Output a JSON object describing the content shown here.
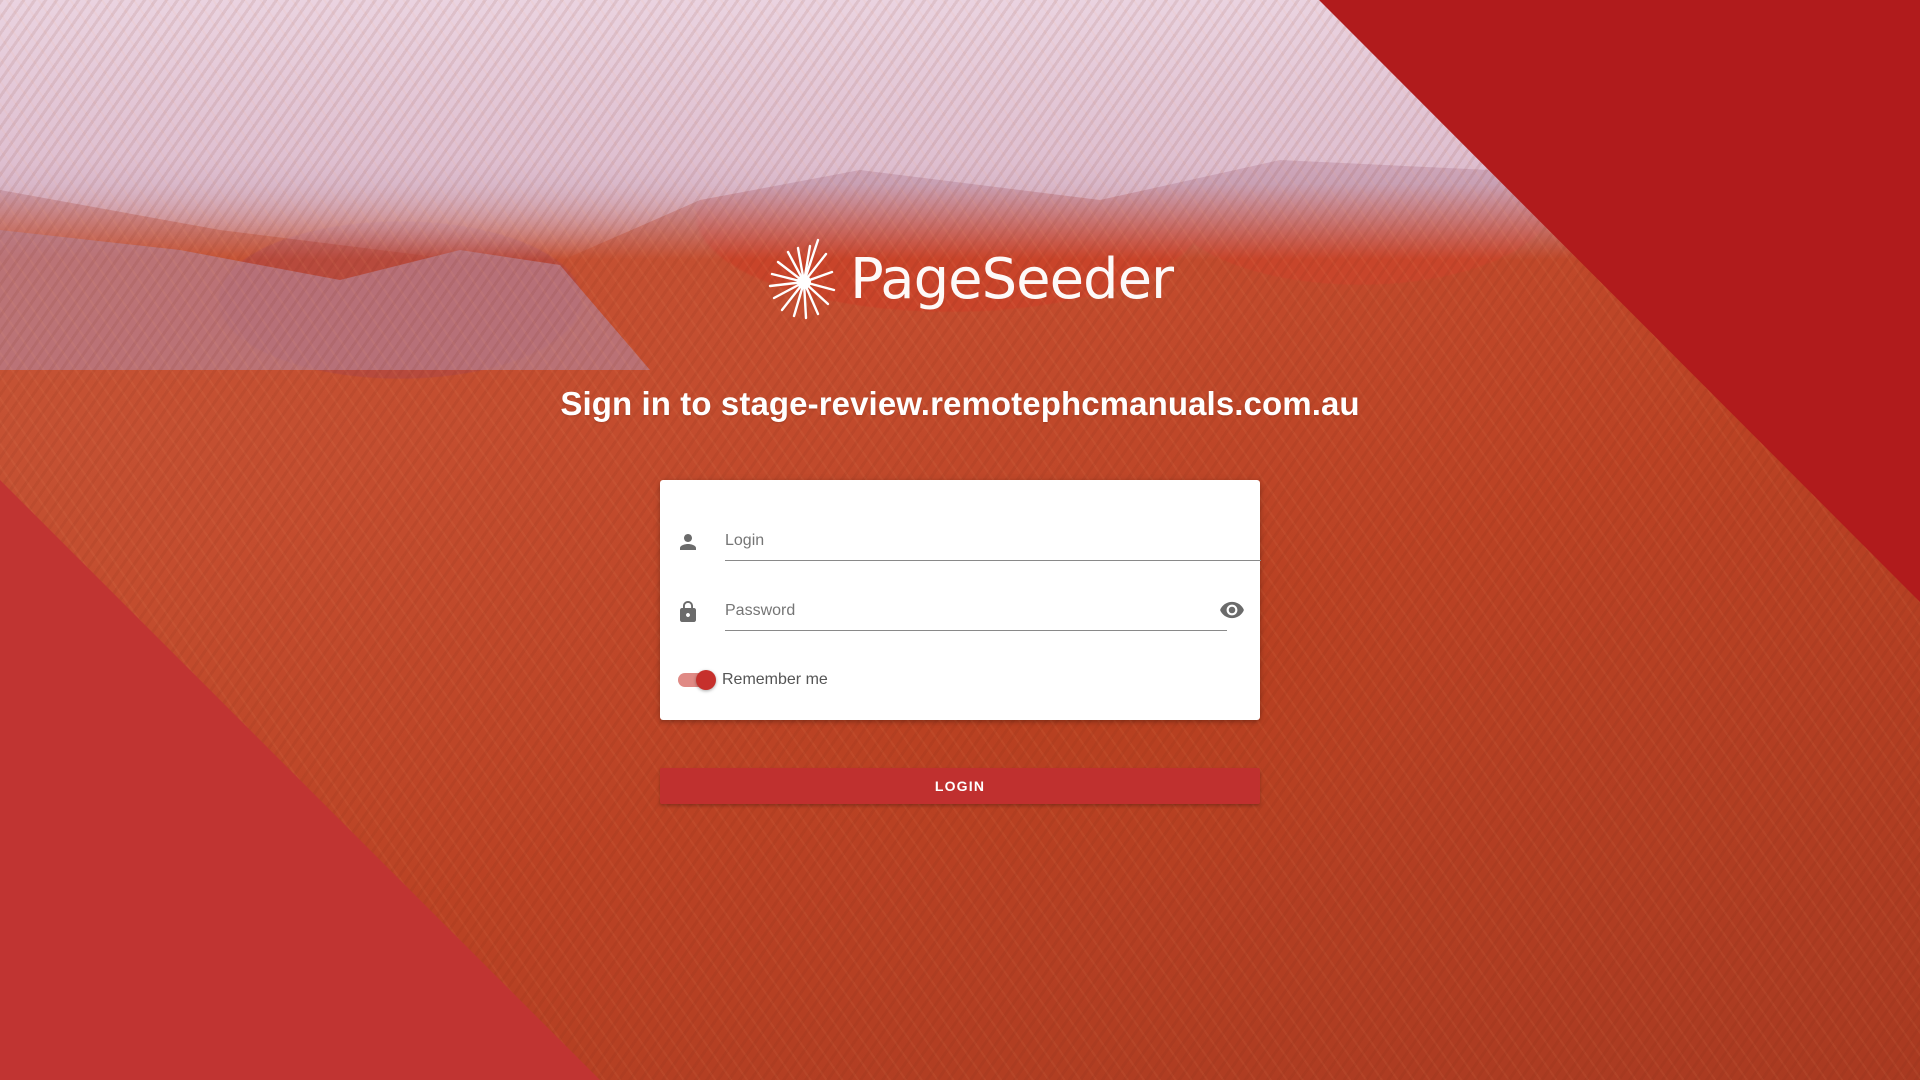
{
  "brand": {
    "name": "PageSeeder",
    "logo_icon": "pageseeder-burst-icon"
  },
  "signin": {
    "title": "Sign in to stage-review.remotephcmanuals.com.au"
  },
  "form": {
    "login": {
      "icon": "person-icon",
      "placeholder": "Login",
      "value": ""
    },
    "password": {
      "icon": "lock-icon",
      "placeholder": "Password",
      "value": "",
      "toggle_icon": "eye-icon"
    },
    "remember": {
      "label": "Remember me",
      "checked": true
    },
    "submit_label": "LOGIN"
  },
  "colors": {
    "accent": "#c0302f",
    "corner_top_right": "#b11b1c",
    "corner_bottom_left": "#c13432",
    "toggle_track": "#e08a85"
  }
}
